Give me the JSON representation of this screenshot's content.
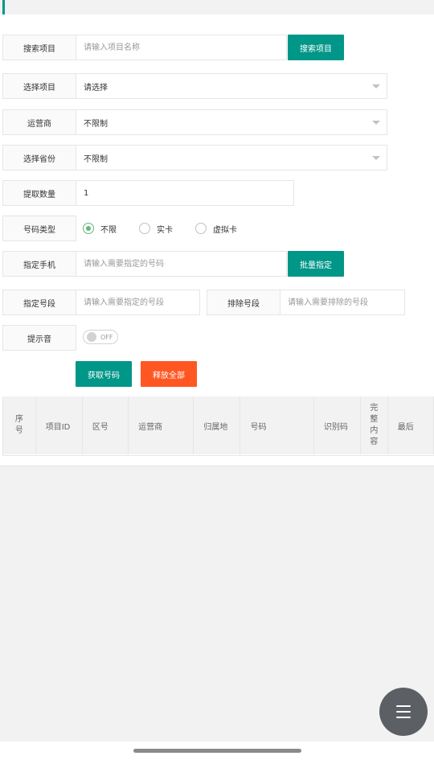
{
  "search_project": {
    "label": "搜索项目",
    "placeholder": "请输入项目名称",
    "button": "搜索项目"
  },
  "select_project": {
    "label": "选择项目",
    "value": "请选择"
  },
  "carrier": {
    "label": "运营商",
    "value": "不限制"
  },
  "province": {
    "label": "选择省份",
    "value": "不限制"
  },
  "quantity": {
    "label": "提取数量",
    "value": "1"
  },
  "number_type": {
    "label": "号码类型",
    "options": [
      {
        "label": "不限",
        "checked": true
      },
      {
        "label": "实卡",
        "checked": false
      },
      {
        "label": "虚拟卡",
        "checked": false
      }
    ]
  },
  "assign_phone": {
    "label": "指定手机",
    "placeholder": "请输入需要指定的号码",
    "button": "批量指定"
  },
  "assign_segment": {
    "label": "指定号段",
    "placeholder": "请输入需要指定的号段"
  },
  "exclude_segment": {
    "label": "排除号段",
    "placeholder": "请输入需要排除的号段"
  },
  "alert_sound": {
    "label": "提示音",
    "switch_text": "OFF",
    "on": false
  },
  "actions": {
    "get_number": "获取号码",
    "release_all": "释放全部"
  },
  "table": {
    "columns": [
      "序号",
      "项目ID",
      "区号",
      "运营商",
      "归属地",
      "号码",
      "识别码",
      "完整内容",
      "最后"
    ]
  },
  "colors": {
    "primary": "#009688",
    "danger": "#ff5722",
    "radio_checked": "#5fb878",
    "fab": "#5c5f63"
  },
  "icons": {
    "fab": "menu-icon",
    "select_caret": "caret-down-icon"
  }
}
